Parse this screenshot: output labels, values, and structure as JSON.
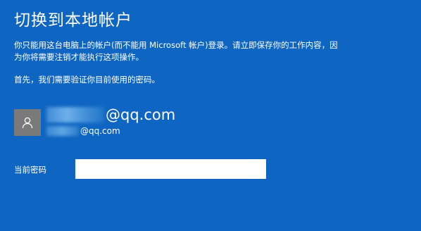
{
  "page": {
    "title": "切换到本地帐户",
    "description_line1": "你只能用这台电脑上的帐户(而不能用 Microsoft 帐户)登录。请立即保存你的工作内容，因",
    "description_line2": "为你将需要注销才能执行这项操作。",
    "intro": "首先，我们需要验证你目前使用的密码。"
  },
  "account": {
    "avatar_icon": "user-icon",
    "display_name": "@qq.com",
    "email": "@qq.com"
  },
  "password": {
    "label": "当前密码",
    "value": ""
  },
  "colors": {
    "background": "#0f66c2",
    "avatar": "#7a7a7a",
    "text": "#ffffff"
  }
}
